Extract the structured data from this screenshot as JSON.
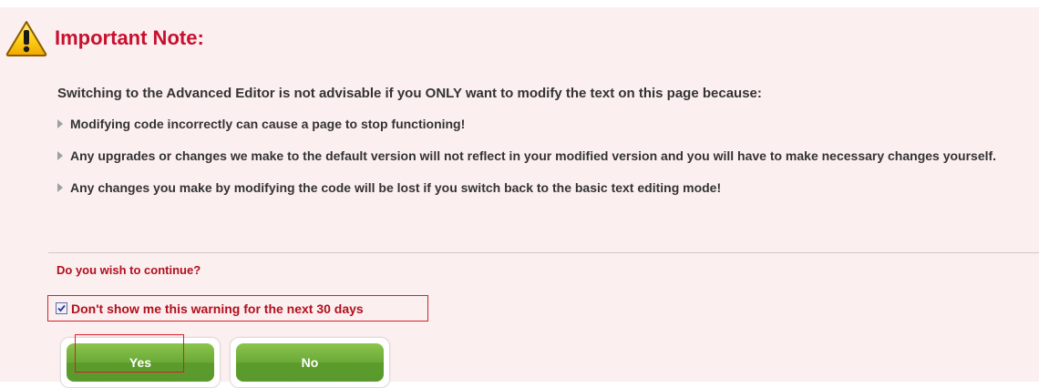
{
  "dialog": {
    "icon": "warning-triangle-icon",
    "title": "Important Note:",
    "intro": "Switching to the Advanced Editor is not advisable if you ONLY want to modify the text on this page because:",
    "bullets": [
      "Modifying code incorrectly can cause a page to stop functioning!",
      "Any upgrades or changes we make to the default version will not reflect in your modified version and you will have to make necessary changes yourself.",
      "Any changes you make by modifying the code will be lost if you switch back to the basic text editing mode!"
    ],
    "question": "Do you wish to continue?",
    "checkbox": {
      "label": "Don't show me this warning for the next 30 days",
      "checked": true
    },
    "buttons": {
      "yes": "Yes",
      "no": "No"
    }
  },
  "colors": {
    "background": "#fcefef",
    "title": "#c8102e",
    "question": "#b0101e",
    "button_green": "#6aa936",
    "highlight_border": "#d4202b"
  }
}
